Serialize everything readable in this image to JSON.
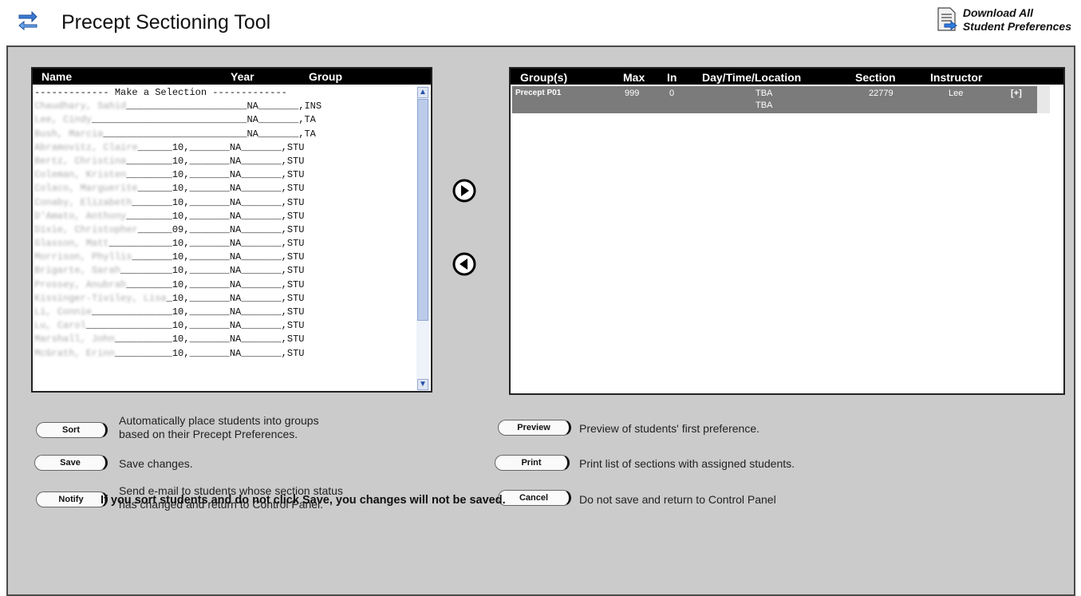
{
  "header": {
    "title": "Precept Sectioning Tool",
    "download_line1": "Download All",
    "download_line2": "Student Preferences",
    "title_icon": "swap-arrows-icon",
    "download_icon": "download-document-icon"
  },
  "students_list": {
    "columns": [
      "Name",
      "Year",
      "Group"
    ],
    "rows": [
      {
        "name": "",
        "text": "------------- Make a Selection -------------"
      },
      {
        "name": "Chaudhary, Sahid",
        "year": "",
        "group": "NA",
        "role": "INS"
      },
      {
        "name": "Lee, Cindy",
        "year": "",
        "group": "NA",
        "role": "TA"
      },
      {
        "name": "Bush, Marcia",
        "year": "",
        "group": "NA",
        "role": "TA"
      },
      {
        "name": "Abramovitz, Claire",
        "year": "10",
        "group": "NA",
        "role": "STU"
      },
      {
        "name": "Bertz, Christina",
        "year": "10",
        "group": "NA",
        "role": "STU"
      },
      {
        "name": "Coleman, Kristen",
        "year": "10",
        "group": "NA",
        "role": "STU"
      },
      {
        "name": "Colaco, Marguerite",
        "year": "10",
        "group": "NA",
        "role": "STU"
      },
      {
        "name": "Conaby, Elizabeth",
        "year": "10",
        "group": "NA",
        "role": "STU"
      },
      {
        "name": "D'Amato, Anthony",
        "year": "10",
        "group": "NA",
        "role": "STU"
      },
      {
        "name": "Dixie, Christopher",
        "year": "09",
        "group": "NA",
        "role": "STU"
      },
      {
        "name": "Glasson, Matt",
        "year": "10",
        "group": "NA",
        "role": "STU"
      },
      {
        "name": "Morrison, Phyllis",
        "year": "10",
        "group": "NA",
        "role": "STU"
      },
      {
        "name": "Brigarte, Sarah",
        "year": "10",
        "group": "NA",
        "role": "STU"
      },
      {
        "name": "Prossey, Anubrah",
        "year": "10",
        "group": "NA",
        "role": "STU"
      },
      {
        "name": "Kissinger-Tiviley, Lisa",
        "year": "10",
        "group": "NA",
        "role": "STU"
      },
      {
        "name": "Li, Connie",
        "year": "10",
        "group": "NA",
        "role": "STU"
      },
      {
        "name": "Lu, Carol",
        "year": "10",
        "group": "NA",
        "role": "STU"
      },
      {
        "name": "Marshall, John",
        "year": "10",
        "group": "NA",
        "role": "STU"
      },
      {
        "name": "McGrath, Erinn",
        "year": "10",
        "group": "NA",
        "role": "STU"
      }
    ]
  },
  "groups_table": {
    "columns": [
      "Group(s)",
      "Max",
      "In",
      "Day/Time/Location",
      "Section",
      "Instructor"
    ],
    "rows": [
      {
        "group": "Precept P01",
        "max": "999",
        "in": "0",
        "dtl1": "TBA",
        "dtl2": "TBA",
        "section": "22779",
        "instructor": "Lee",
        "expand": "[+]"
      }
    ]
  },
  "move_buttons": {
    "right_icon": "arrow-right-circle-icon",
    "left_icon": "arrow-left-circle-icon"
  },
  "actions": {
    "sort_label": "Sort",
    "sort_desc1": "Automatically place students into groups",
    "sort_desc2": "based on their Precept Preferences.",
    "save_label": "Save",
    "save_desc": "Save changes.",
    "notify_label": "Notify",
    "notify_desc1": "Send e-mail to students whose section status",
    "notify_desc2": "has changed and return to Control Panel.",
    "preview_label": "Preview",
    "preview_desc": "Preview of students' first preference.",
    "print_label": "Print",
    "print_desc": "Print list of sections with assigned students.",
    "cancel_label": "Cancel",
    "cancel_desc": "Do not save and return to Control Panel"
  },
  "warning": "If you sort students and do not click Save, you changes will not be saved."
}
